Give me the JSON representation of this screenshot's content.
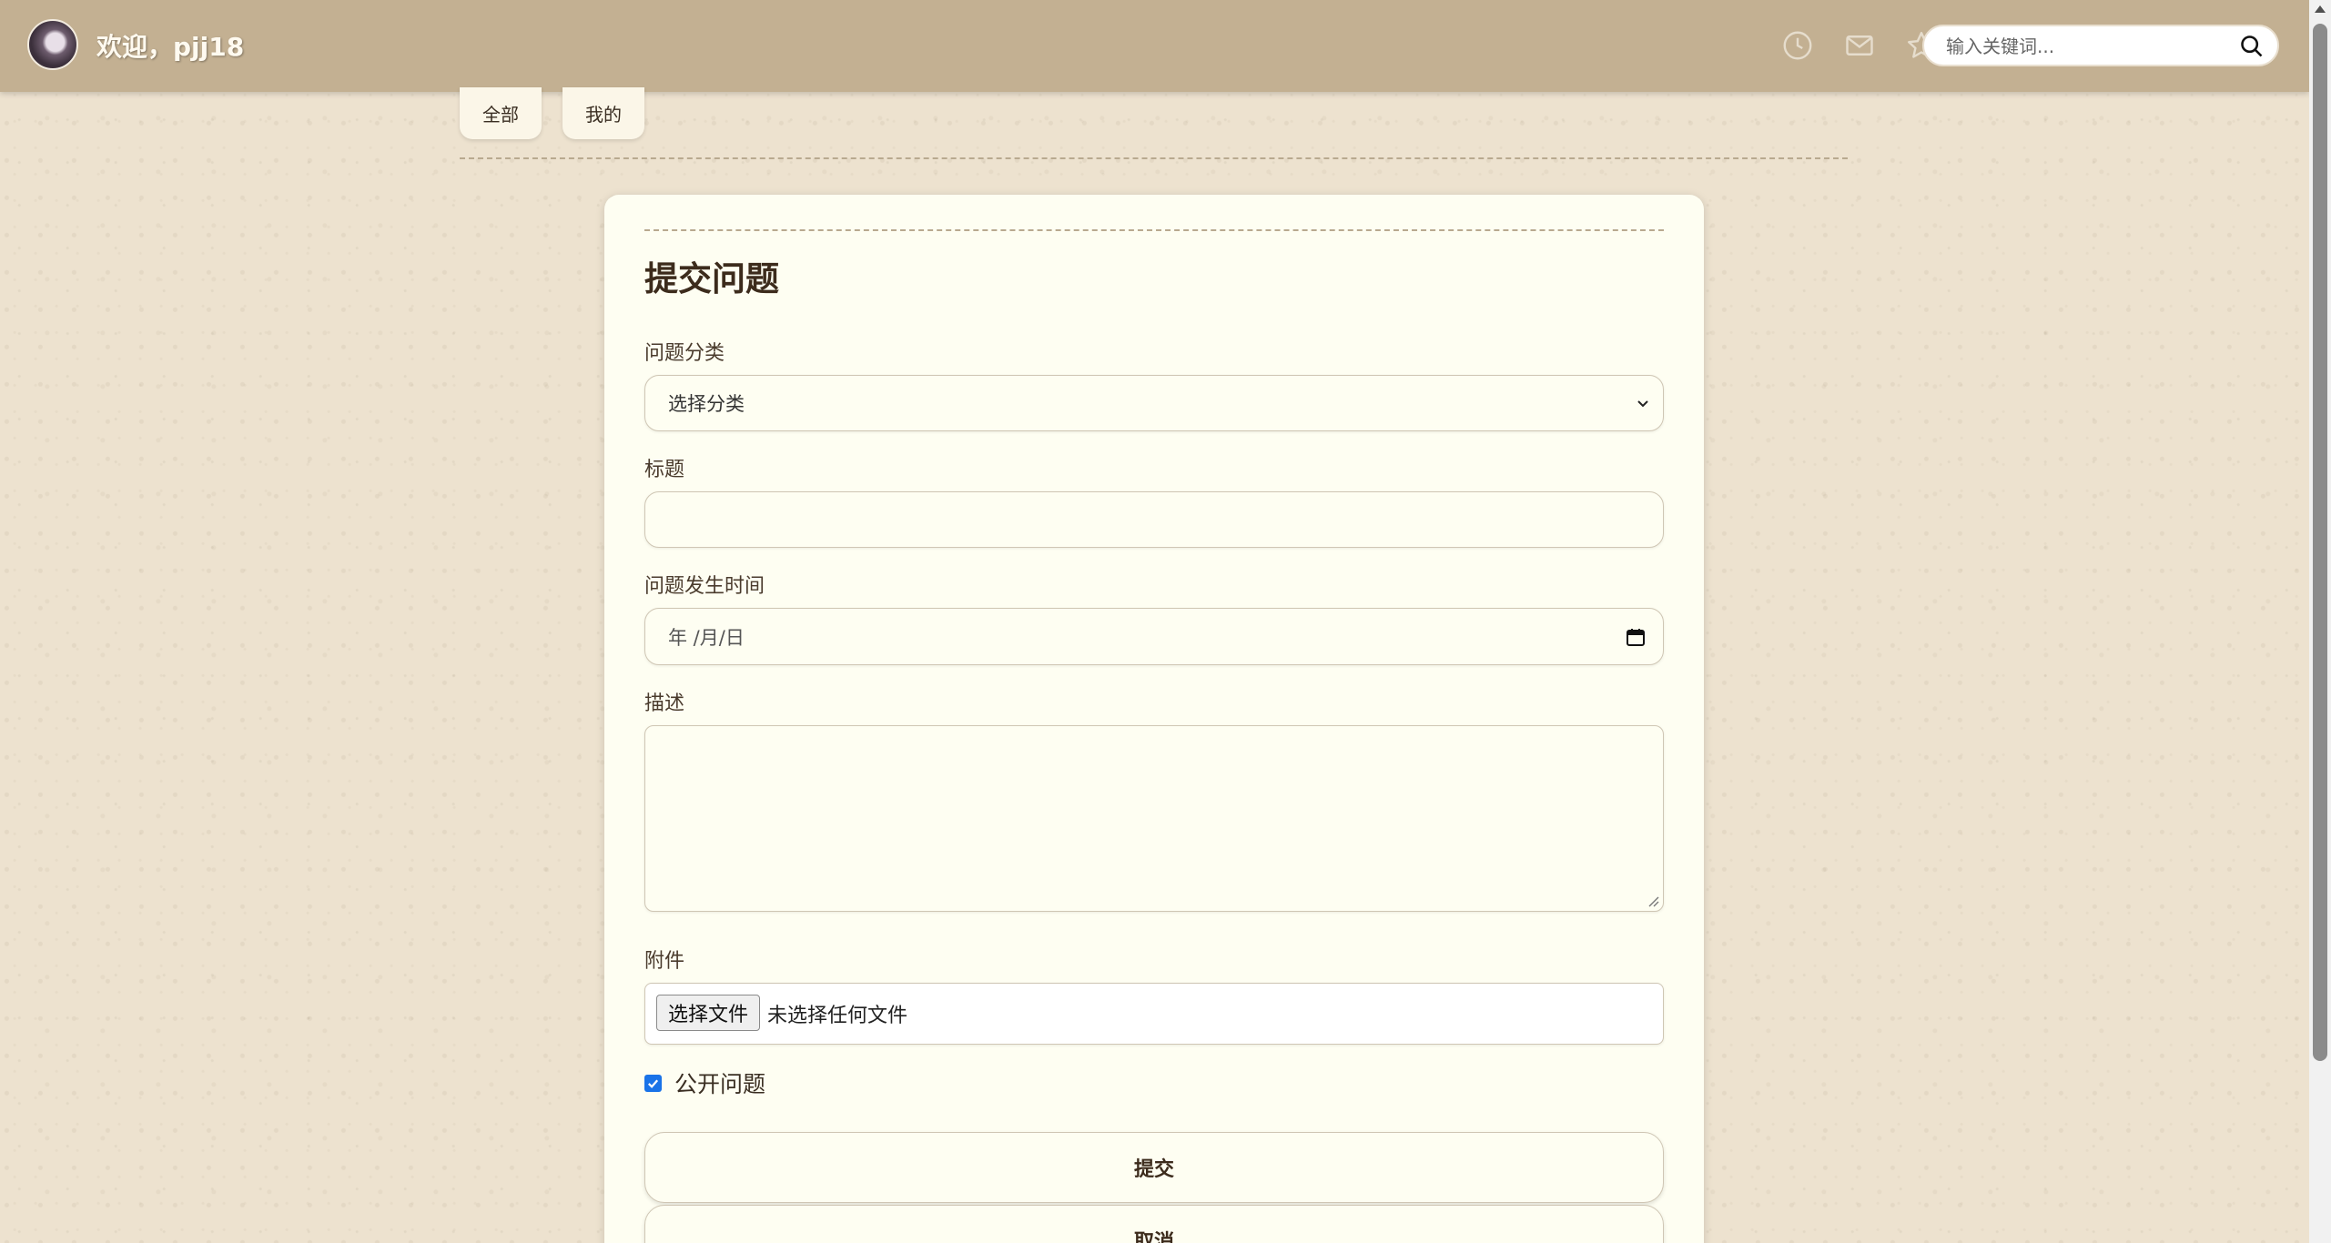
{
  "header": {
    "welcome": "欢迎，pjj18",
    "icons": [
      "clock-icon",
      "mail-icon",
      "star-icon"
    ],
    "search_placeholder": "输入关键词..."
  },
  "tabs": [
    {
      "label": "全部"
    },
    {
      "label": "我的"
    }
  ],
  "form": {
    "title": "提交问题",
    "category_label": "问题分类",
    "category_value": "选择分类",
    "title_label": "标题",
    "title_value": "",
    "time_label": "问题发生时间",
    "time_placeholder": "年 /月/日",
    "desc_label": "描述",
    "desc_value": "",
    "attachment_label": "附件",
    "file_button": "选择文件",
    "file_status": "未选择任何文件",
    "public_label": "公开问题",
    "public_checked": true,
    "submit_label": "提交",
    "cancel_label": "取消"
  },
  "colors": {
    "header_bg": "#c3b092",
    "page_bg": "#ede2cf",
    "card_bg": "#fefef2",
    "title_text": "#3c2b1c",
    "checkbox": "#1a73e8"
  }
}
